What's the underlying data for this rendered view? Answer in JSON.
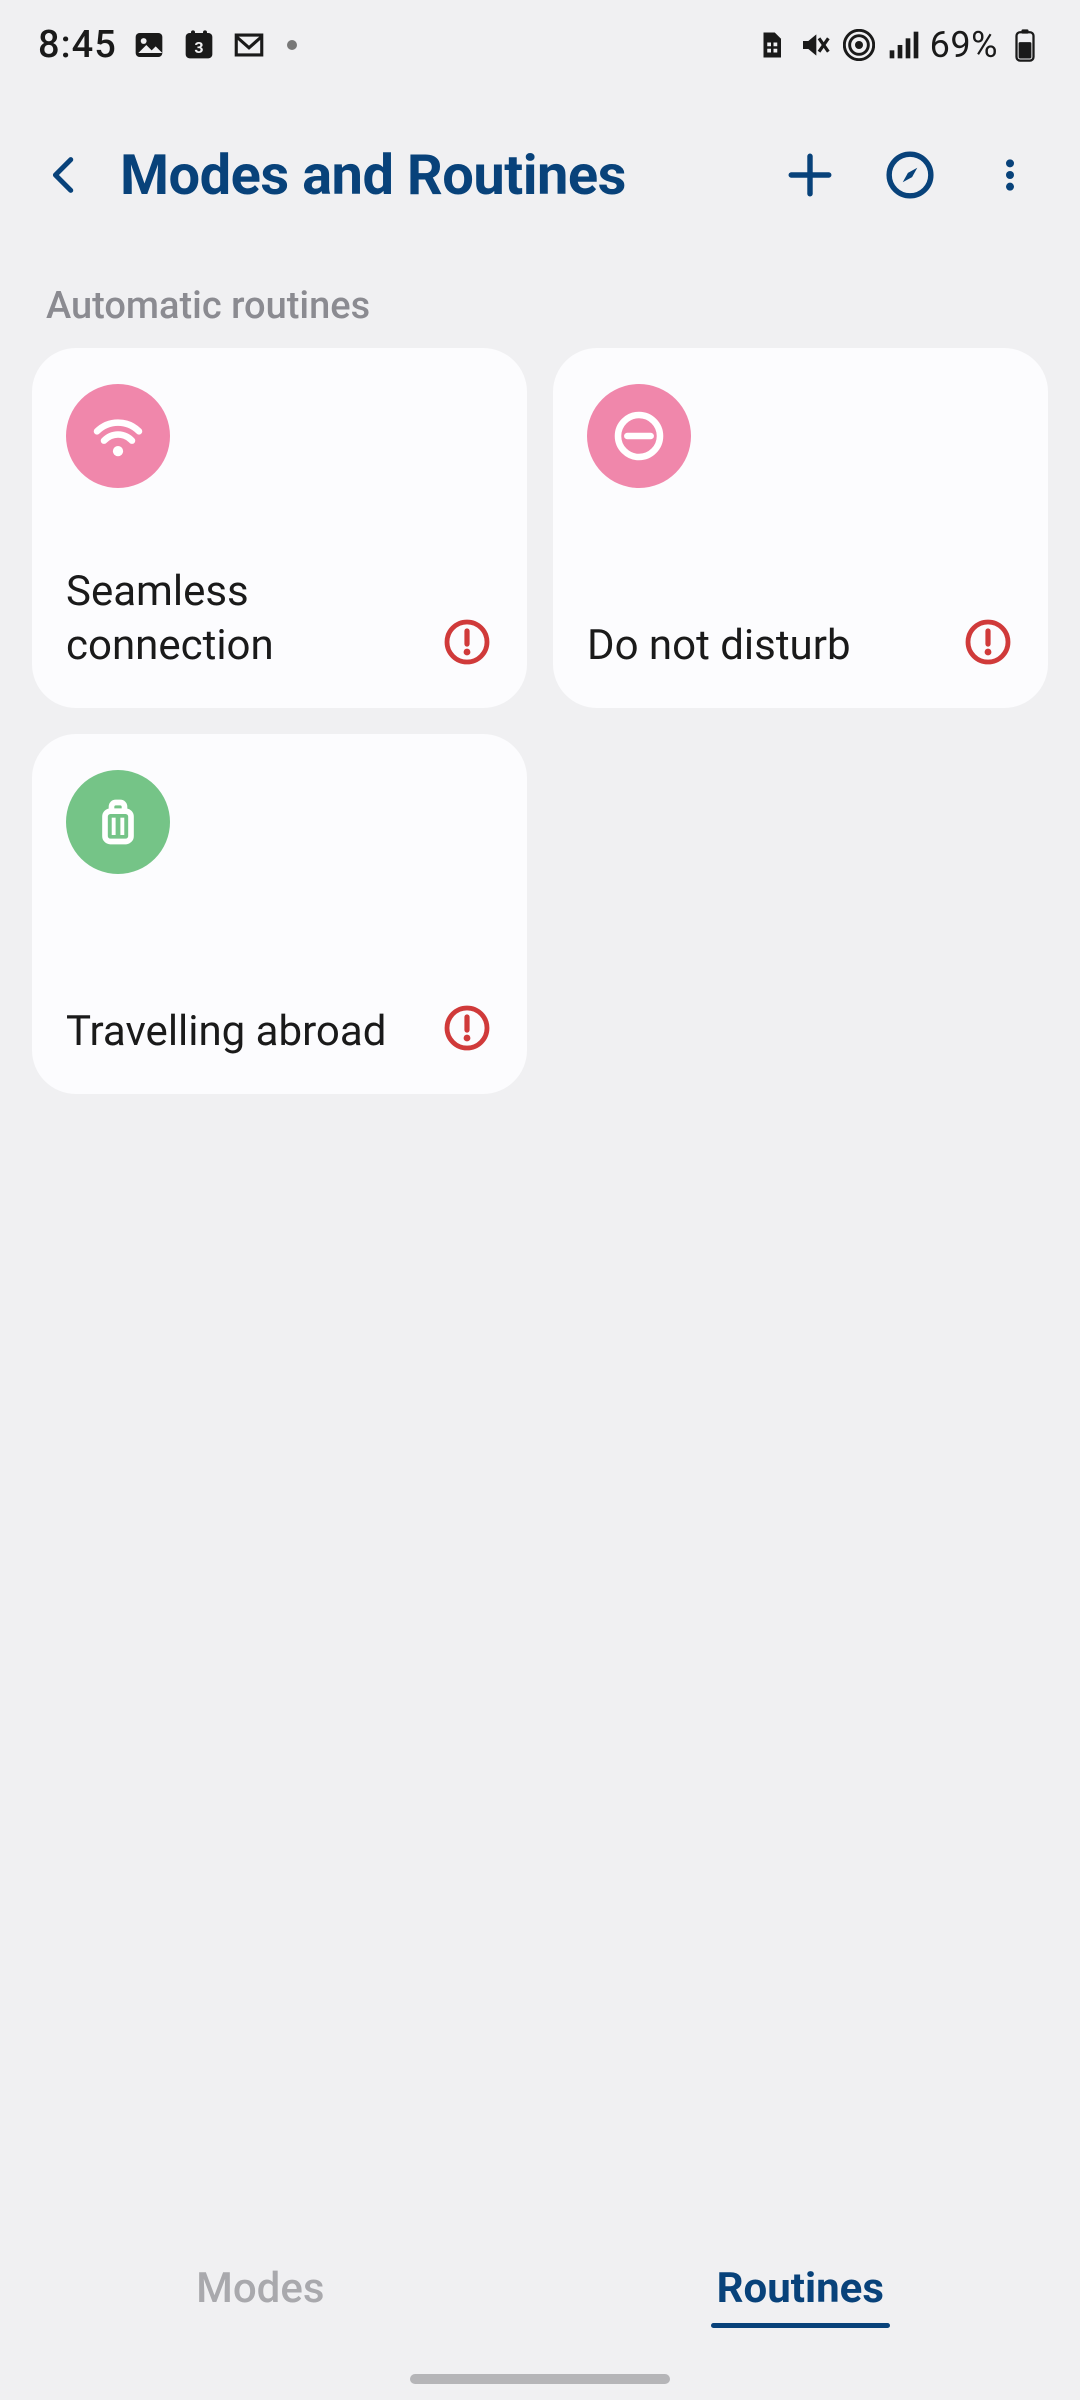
{
  "status": {
    "time": "8:45",
    "battery": "69%",
    "calendar_day": "3"
  },
  "header": {
    "title": "Modes and Routines"
  },
  "section": {
    "title": "Automatic routines"
  },
  "routines": [
    {
      "label": "Seamless connection",
      "icon": "wifi",
      "color": "pink",
      "alert": true
    },
    {
      "label": "Do not disturb",
      "icon": "minus-circle",
      "color": "pink",
      "alert": true
    },
    {
      "label": "Travelling abroad",
      "icon": "suitcase",
      "color": "green",
      "alert": true
    }
  ],
  "tabs": {
    "modes": "Modes",
    "routines": "Routines",
    "active": "routines"
  },
  "colors": {
    "accent": "#08427a",
    "pink": "#f087ab",
    "green": "#75c487",
    "alert": "#d03a3a"
  }
}
